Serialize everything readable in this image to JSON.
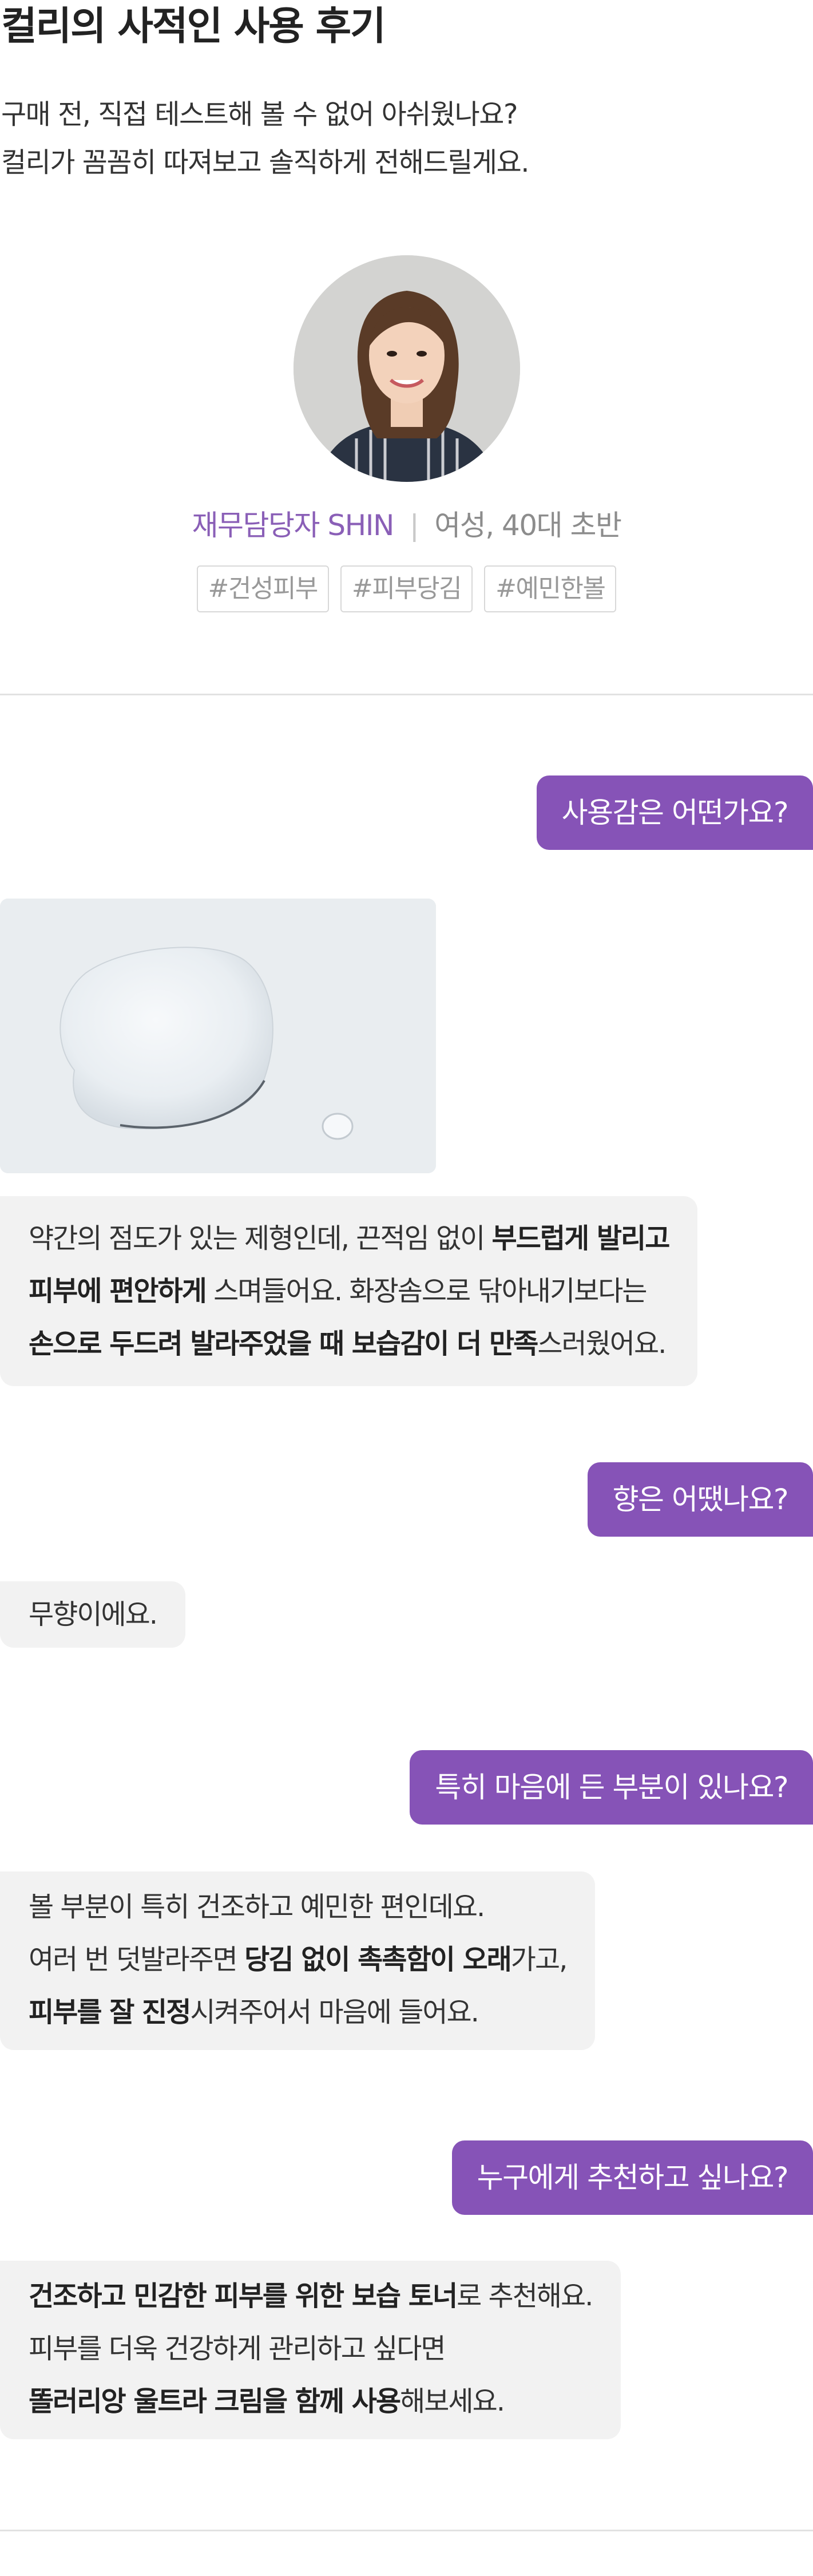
{
  "title": "컬리의 사적인 사용 후기",
  "intro": {
    "line1": "구매 전, 직접 테스트해 볼 수 없어 아쉬웠나요?",
    "line2": "컬리가 꼼꼼히 따져보고 솔직하게 전해드릴게요."
  },
  "reviewer": {
    "role": "재무담당자 SHIN",
    "separator": "|",
    "meta": "여성, 40대 초반",
    "tags": [
      "#건성피부",
      "#피부당김",
      "#예민한볼"
    ]
  },
  "qa": [
    {
      "question": "사용감은 어떤가요?",
      "answer": [
        [
          {
            "t": "약간의 점도가 있는 제형인데, 끈적임 없이 "
          },
          {
            "t": "부드럽게 발리고",
            "b": true
          }
        ],
        [
          {
            "t": "피부에 편안하게",
            "b": true
          },
          {
            "t": " 스며들어요. 화장솜으로 닦아내기보다는"
          }
        ],
        [
          {
            "t": "손으로 두드려 발라주었을 때 보습감이 더 만족",
            "b": true
          },
          {
            "t": "스러웠어요."
          }
        ]
      ]
    },
    {
      "question": "향은 어땠나요?",
      "answer": [
        [
          {
            "t": "무향이에요."
          }
        ]
      ]
    },
    {
      "question": "특히 마음에 든 부분이 있나요?",
      "answer": [
        [
          {
            "t": "볼 부분이 특히 건조하고 예민한 편인데요."
          }
        ],
        [
          {
            "t": "여러 번 덧발라주면 "
          },
          {
            "t": "당김 없이 촉촉함이 오래",
            "b": true
          },
          {
            "t": "가고,"
          }
        ],
        [
          {
            "t": "피부를 잘 진정",
            "b": true
          },
          {
            "t": "시켜주어서 마음에 들어요."
          }
        ]
      ]
    },
    {
      "question": "누구에게 추천하고 싶나요?",
      "answer": [
        [
          {
            "t": "건조하고 민감한 피부를 위한 보습 토너",
            "b": true
          },
          {
            "t": "로 추천해요."
          }
        ],
        [
          {
            "t": "피부를 더욱 건강하게 관리하고 싶다면"
          }
        ],
        [
          {
            "t": "똘러리앙 울트라 크림을 함께 사용",
            "b": true
          },
          {
            "t": "해보세요."
          }
        ]
      ]
    }
  ],
  "colors": {
    "accent": "#8653b7",
    "role_text": "#8a5fb7",
    "bubble_bg": "#f2f2f2",
    "divider": "#e2e2e2"
  }
}
